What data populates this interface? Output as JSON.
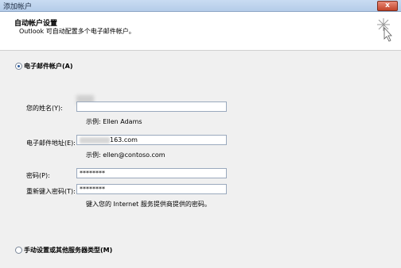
{
  "window": {
    "title": "添加帐户",
    "close": "x"
  },
  "header": {
    "title": "自动帐户设置",
    "subtitle": "Outlook 可自动配置多个电子邮件帐户。"
  },
  "option_email": {
    "label": "电子邮件帐户(A)"
  },
  "name": {
    "label": "您的姓名(Y):",
    "value": "",
    "example": "示例: Ellen Adams"
  },
  "email": {
    "label": "电子邮件地址(E):",
    "value": "163.com",
    "example": "示例: ellen@contoso.com"
  },
  "password": {
    "label": "密码(P):",
    "value": "********"
  },
  "password_confirm": {
    "label": "重新键入密码(T):",
    "value": "********",
    "hint": "键入您的 Internet 服务提供商提供的密码。"
  },
  "option_manual": {
    "label": "手动设置或其他服务器类型(M)"
  }
}
